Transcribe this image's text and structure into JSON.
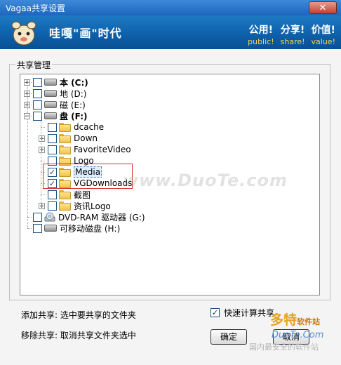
{
  "window": {
    "title": "Vagaa共享设置",
    "close_glyph": "✕"
  },
  "header": {
    "brand": "哇嘎\"画\"时代",
    "slogans": [
      {
        "zh": "公用!",
        "en": "public!"
      },
      {
        "zh": "分享!",
        "en": "share!"
      },
      {
        "zh": "价值!",
        "en": "value!"
      }
    ]
  },
  "group": {
    "label": "共享管理"
  },
  "tree": [
    {
      "label": "本 (C:)",
      "icon": "drive-icon",
      "expander": "+",
      "checked": false,
      "bold": true
    },
    {
      "label": "地 (D:)",
      "icon": "drive-icon",
      "expander": "+",
      "checked": false,
      "bold": false
    },
    {
      "label": "磁 (E:)",
      "icon": "drive-icon",
      "expander": "+",
      "checked": false,
      "bold": false
    },
    {
      "label": "盘 (F:)",
      "icon": "drive-icon",
      "expander": "−",
      "checked": false,
      "bold": true
    },
    {
      "label": "dcache",
      "icon": "folder-icon",
      "expander": "",
      "checked": false
    },
    {
      "label": "Down",
      "icon": "folder-icon",
      "expander": "+",
      "checked": false
    },
    {
      "label": "FavoriteVideo",
      "icon": "folder-icon",
      "expander": "+",
      "checked": false
    },
    {
      "label": "Logo",
      "icon": "folder-icon",
      "expander": "",
      "checked": false
    },
    {
      "label": "Media",
      "icon": "folder-icon",
      "expander": "",
      "checked": true,
      "selected": true
    },
    {
      "label": "VGDownloads",
      "icon": "folder-icon",
      "expander": "",
      "checked": true
    },
    {
      "label": "截图",
      "icon": "folder-icon",
      "expander": "",
      "checked": false
    },
    {
      "label": "资讯Logo",
      "icon": "folder-icon",
      "expander": "+",
      "checked": false
    },
    {
      "label": "DVD-RAM 驱动器 (G:)",
      "icon": "cdrom-icon",
      "expander": "",
      "checked": false
    },
    {
      "label": "可移动磁盘 (H:)",
      "icon": "drive-icon",
      "expander": "",
      "checked": false
    }
  ],
  "watermark": "www.DuoTe.com",
  "hints": {
    "add": "添加共享: 选中要共享的文件夹",
    "remove": "移除共享: 取消共享文件夹选中"
  },
  "options": {
    "fast_calc_label": "快速计算共享",
    "fast_calc_checked": true,
    "check_glyph": "✓"
  },
  "buttons": {
    "ok": "确定",
    "cancel": "取消"
  },
  "site_watermark": {
    "name": "多特",
    "name_small": "软件站",
    "domain": "DuoTe.Com",
    "slogan": "国内最安全的软件站"
  }
}
